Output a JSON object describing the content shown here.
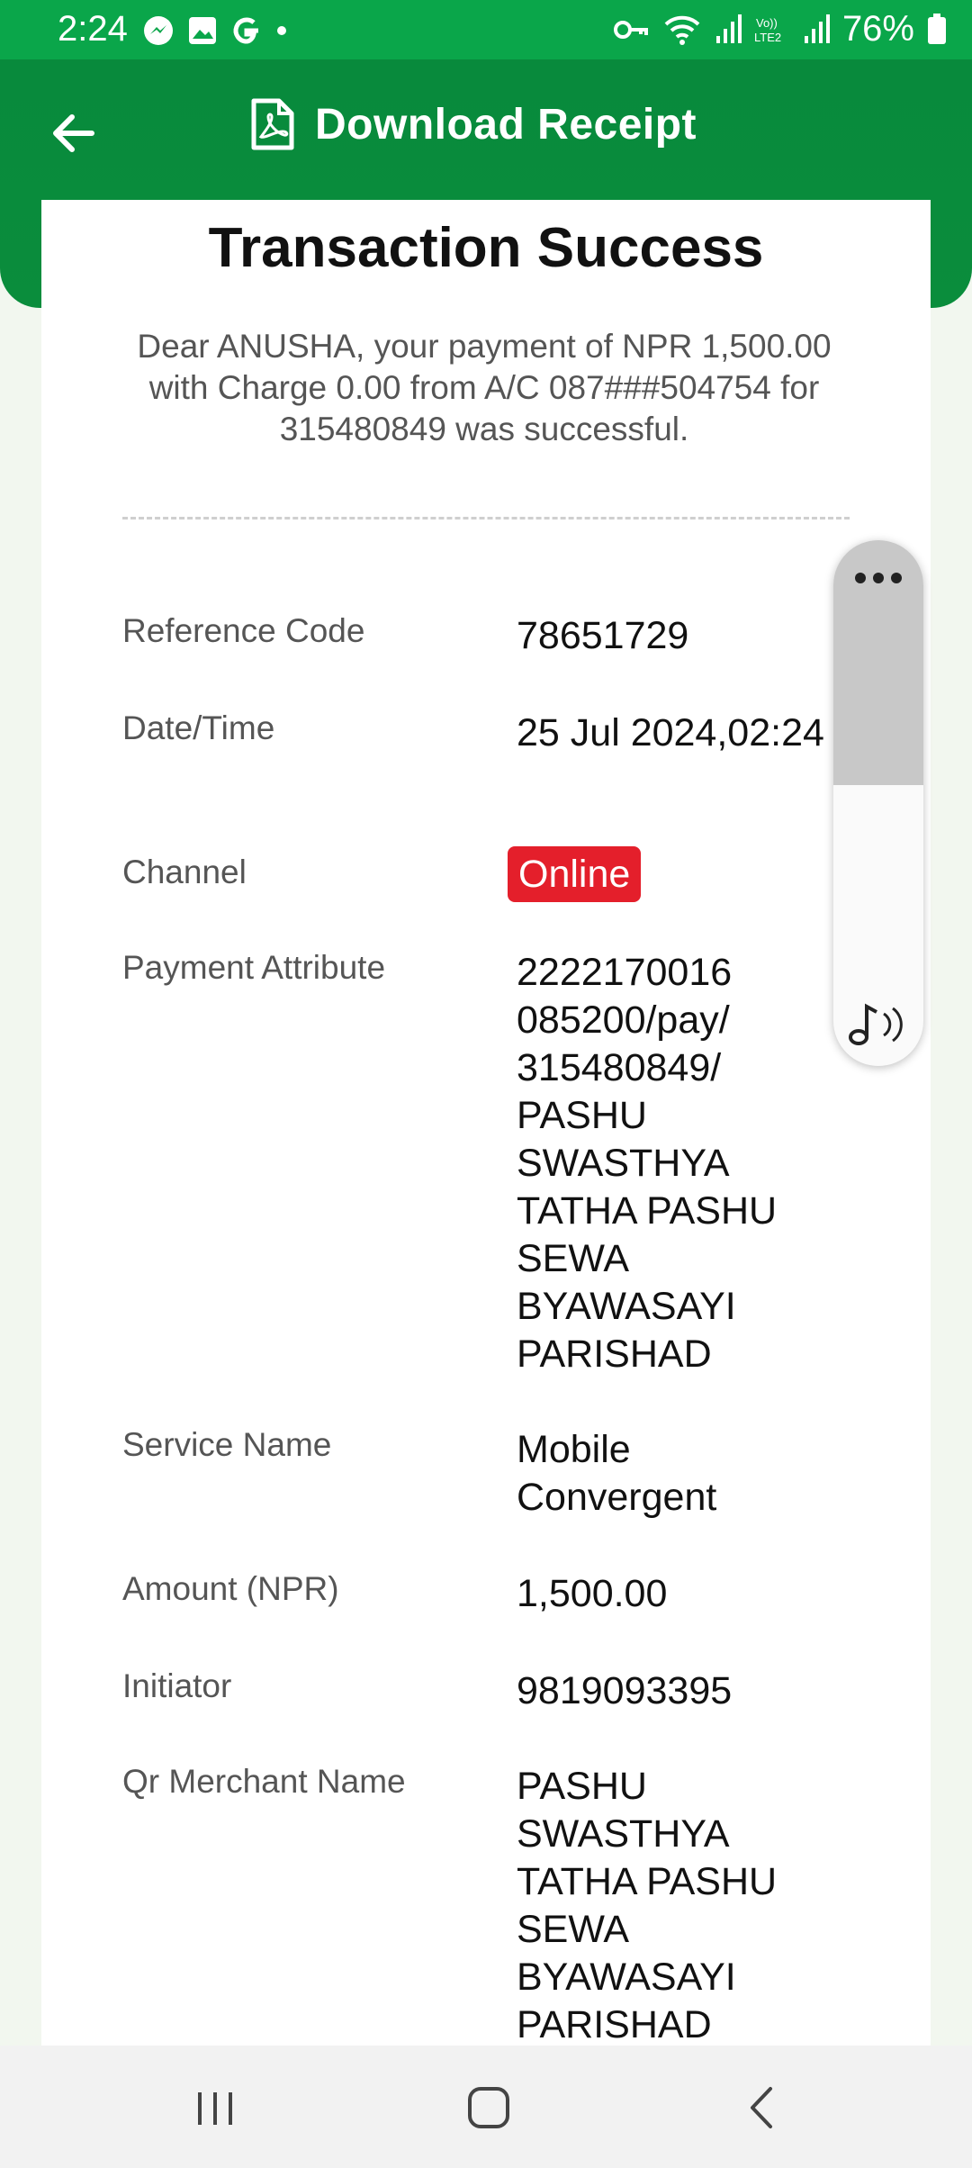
{
  "status": {
    "time": "2:24",
    "battery": "76%"
  },
  "header": {
    "title": "Download Receipt"
  },
  "receipt": {
    "title": "Transaction Success",
    "message": "Dear ANUSHA, your payment of NPR 1,500.00 with Charge 0.00 from A/C 087###504754 for 315480849 was successful.",
    "rows": [
      {
        "label": "Reference Code",
        "value": "78651729"
      },
      {
        "label": "Date/Time",
        "value": "25 Jul 2024,02:24 PM"
      },
      {
        "label": "Channel",
        "value": "Online"
      },
      {
        "label": "Payment Attribute",
        "value": "2222170016 085200/pay/ 315480849/ PASHU SWASTHYA TATHA PASHU SEWA BYAWASAYI PARISHAD"
      },
      {
        "label": "Service Name",
        "value": "Mobile Convergent"
      },
      {
        "label": "Amount (NPR)",
        "value": "1,500.00"
      },
      {
        "label": "Initiator",
        "value": "9819093395"
      },
      {
        "label": "Qr Merchant Name",
        "value": "PASHU SWASTHYA TATHA PASHU SEWA BYAWASAYI PARISHAD"
      }
    ]
  },
  "floating_widget": {
    "menu_icon": "more-dots-icon",
    "audio_icon": "music-note-icon"
  },
  "colors": {
    "brand_green": "#0a8d3c",
    "badge_red": "#e41f2b"
  }
}
